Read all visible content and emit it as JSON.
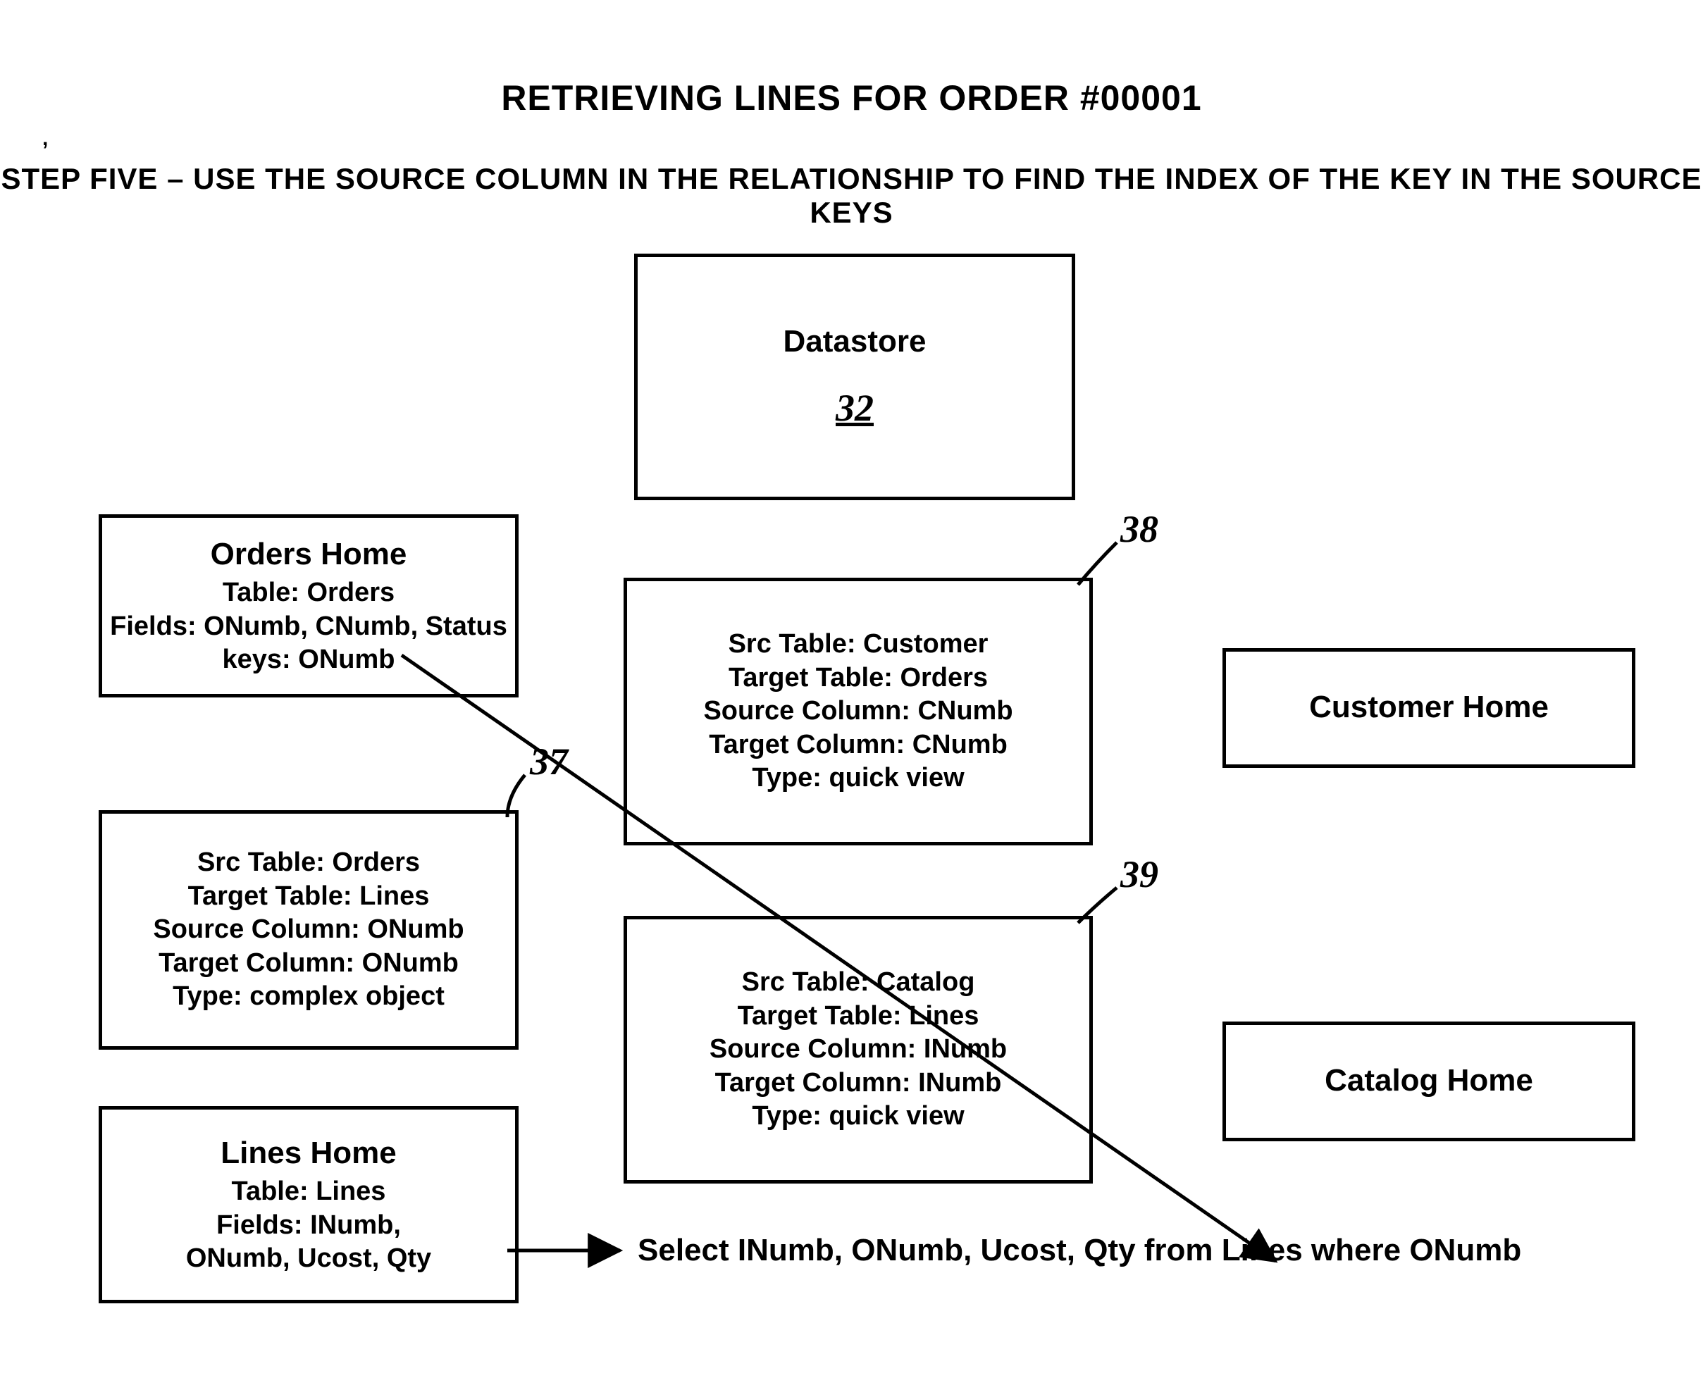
{
  "title_main": "RETRIEVING LINES FOR ORDER #00001",
  "title_step": "STEP FIVE – USE THE SOURCE COLUMN IN THE RELATIONSHIP TO FIND THE INDEX OF THE KEY IN THE SOURCE KEYS",
  "datastore": {
    "label": "Datastore",
    "ref": "32"
  },
  "orders_home": {
    "heading": "Orders Home",
    "l1": "Table: Orders",
    "l2": "Fields: ONumb, CNumb, Status",
    "l3": "keys: ONumb"
  },
  "customer_home": {
    "heading": "Customer Home"
  },
  "catalog_home": {
    "heading": "Catalog Home"
  },
  "lines_home": {
    "heading": "Lines Home",
    "l1": "Table: Lines",
    "l2": "Fields: INumb,",
    "l3": "ONumb, Ucost, Qty"
  },
  "rel37": {
    "ref": "37",
    "l1": "Src Table: Orders",
    "l2": "Target Table: Lines",
    "l3": "Source Column: ONumb",
    "l4": "Target Column: ONumb",
    "l5": "Type: complex object"
  },
  "rel38": {
    "ref": "38",
    "l1": "Src Table: Customer",
    "l2": "Target Table: Orders",
    "l3": "Source Column: CNumb",
    "l4": "Target Column: CNumb",
    "l5": "Type: quick view"
  },
  "rel39": {
    "ref": "39",
    "l1": "Src Table: Catalog",
    "l2": "Target Table: Lines",
    "l3": "Source Column: INumb",
    "l4": "Target Column: INumb",
    "l5": "Type: quick view"
  },
  "sql": "Select INumb, ONumb, Ucost, Qty from Lines where ONumb"
}
